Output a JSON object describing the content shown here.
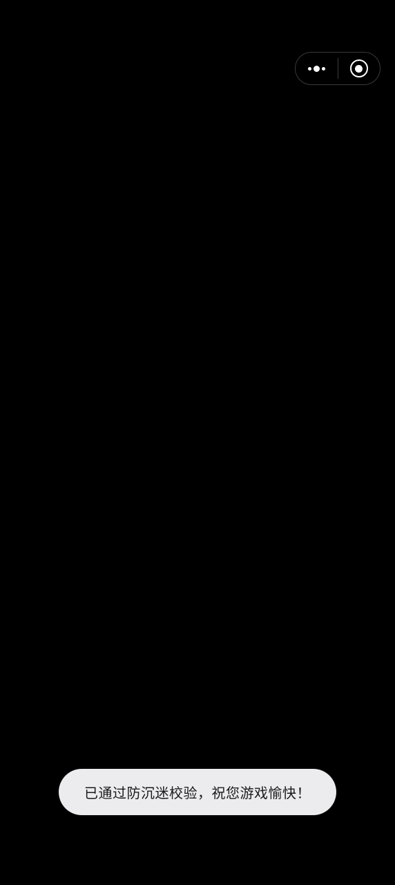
{
  "capsule": {
    "more_icon": "more-dots-icon",
    "close_icon": "target-close-icon"
  },
  "toast": {
    "message": "已通过防沉迷校验，祝您游戏愉快！"
  },
  "colors": {
    "background": "#000000",
    "toast_background": "#ececee",
    "toast_text": "#1a1a1a",
    "capsule_icons": "#ffffff"
  }
}
